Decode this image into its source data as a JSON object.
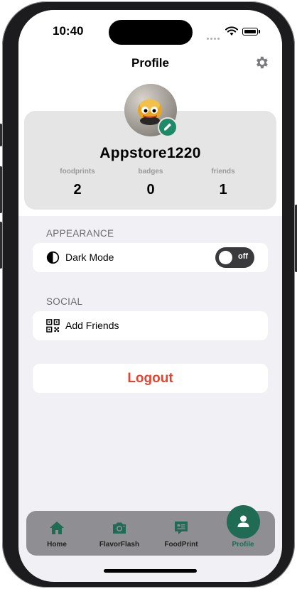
{
  "status_bar": {
    "time": "10:40"
  },
  "header": {
    "title": "Profile"
  },
  "profile": {
    "username": "Appstore1220",
    "stats": [
      {
        "label": "foodprints",
        "value": "2"
      },
      {
        "label": "badges",
        "value": "0"
      },
      {
        "label": "friends",
        "value": "1"
      }
    ]
  },
  "appearance": {
    "section_title": "APPEARANCE",
    "dark_mode_label": "Dark Mode",
    "toggle_text": "off"
  },
  "social": {
    "section_title": "SOCIAL",
    "add_friends_label": "Add Friends"
  },
  "logout": {
    "label": "Logout"
  },
  "tabbar": {
    "tabs": [
      {
        "label": "Home",
        "icon": "home-icon"
      },
      {
        "label": "FlavorFlash",
        "icon": "camera-icon"
      },
      {
        "label": "FoodPrint",
        "icon": "chat-bubble-icon"
      },
      {
        "label": "Profile",
        "icon": "person-icon"
      }
    ],
    "active_tab": "Profile"
  },
  "colors": {
    "accent": "#1f6b54",
    "accent_edit": "#1f8a68",
    "logout": "#e8432f",
    "tabbar": "#8e8e93",
    "toggle_off": "#3a3a3c"
  }
}
